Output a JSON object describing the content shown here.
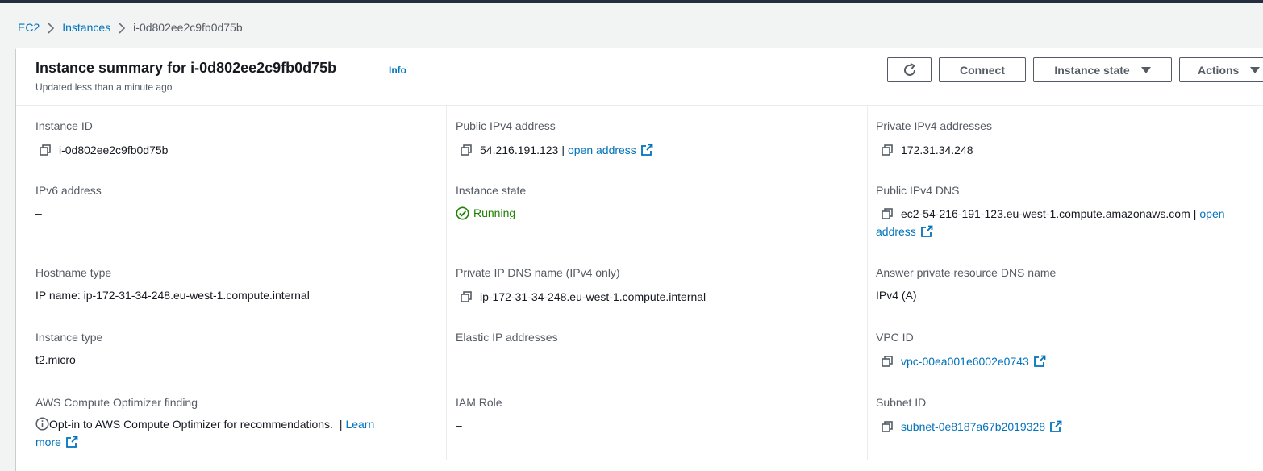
{
  "breadcrumb": {
    "items": [
      "EC2",
      "Instances"
    ],
    "current": "i-0d802ee2c9fb0d75b"
  },
  "header": {
    "title": "Instance summary for i-0d802ee2c9fb0d75b",
    "info": "Info",
    "subtitle": "Updated less than a minute ago",
    "buttons": {
      "refresh_icon": "refresh-icon",
      "connect": "Connect",
      "instance_state": "Instance state",
      "actions": "Actions"
    }
  },
  "details": {
    "instance_id": {
      "label": "Instance ID",
      "value": "i-0d802ee2c9fb0d75b"
    },
    "ipv6": {
      "label": "IPv6 address",
      "value": "–"
    },
    "hostname_type": {
      "label": "Hostname type",
      "value": "IP name: ip-172-31-34-248.eu-west-1.compute.internal"
    },
    "instance_type": {
      "label": "Instance type",
      "value": "t2.micro"
    },
    "optimizer": {
      "label": "AWS Compute Optimizer finding",
      "value": "Opt-in to AWS Compute Optimizer for recommendations.",
      "link_learn": "Learn",
      "link_more": "more"
    },
    "public_ipv4": {
      "label": "Public IPv4 address",
      "value": "54.216.191.123",
      "sep": "|",
      "link": "open address"
    },
    "instance_state": {
      "label": "Instance state",
      "value": "Running"
    },
    "private_dns": {
      "label": "Private IP DNS name (IPv4 only)",
      "value": "ip-172-31-34-248.eu-west-1.compute.internal"
    },
    "elastic_ip": {
      "label": "Elastic IP addresses",
      "value": "–"
    },
    "iam_role": {
      "label": "IAM Role",
      "value": "–"
    },
    "private_ipv4": {
      "label": "Private IPv4 addresses",
      "value": "172.31.34.248"
    },
    "public_dns": {
      "label": "Public IPv4 DNS",
      "value": "ec2-54-216-191-123.eu-west-1.compute.amazonaws.com",
      "sep": "|",
      "link_open": "open",
      "link_address": "address"
    },
    "answer_dns": {
      "label": "Answer private resource DNS name",
      "value": "IPv4 (A)"
    },
    "vpc_id": {
      "label": "VPC ID",
      "value": "vpc-00ea001e6002e0743"
    },
    "subnet_id": {
      "label": "Subnet ID",
      "value": "subnet-0e8187a67b2019328"
    }
  },
  "colors": {
    "link": "#0073bb",
    "running": "#1d8102",
    "text": "#16191f",
    "label": "#545b64"
  }
}
